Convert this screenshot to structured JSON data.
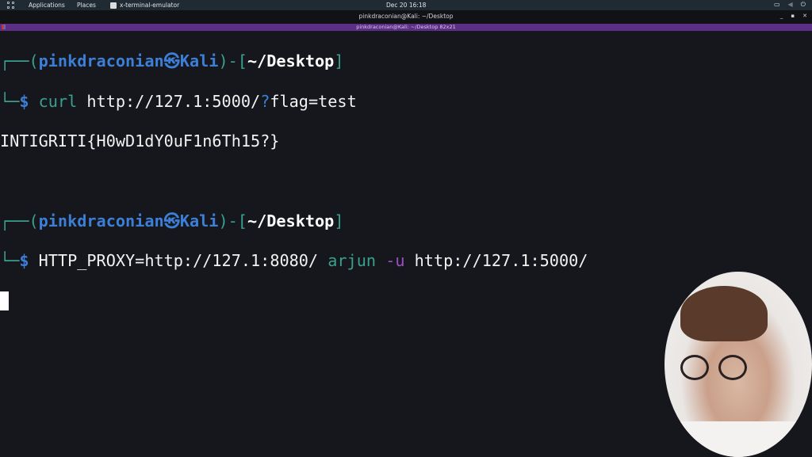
{
  "panel": {
    "applications": "Applications",
    "places": "Places",
    "active_app": "x-terminal-emulator",
    "clock": "Dec 20  16:18"
  },
  "window": {
    "title": "pinkdraconian@Kali: ~/Desktop",
    "tab_title": "pinkdraconian@Kali: ~/Desktop 82x21"
  },
  "terminal": {
    "prompt1": {
      "user": "pinkdraconian",
      "host": "Kali",
      "cwd": "~/Desktop",
      "cmd": "curl",
      "arg_a": " http://127.1:5000/",
      "arg_q": "?",
      "arg_b": "flag=test"
    },
    "output1": "INTIGRITI{H0wD1dY0uF1n6Th15?}",
    "prompt2": {
      "user": "pinkdraconian",
      "host": "Kali",
      "cwd": "~/Desktop",
      "env": "HTTP_PROXY=http://127.1:8080/",
      "cmd": "arjun",
      "flag": "-u",
      "url": "http://127.1:5000/"
    }
  }
}
